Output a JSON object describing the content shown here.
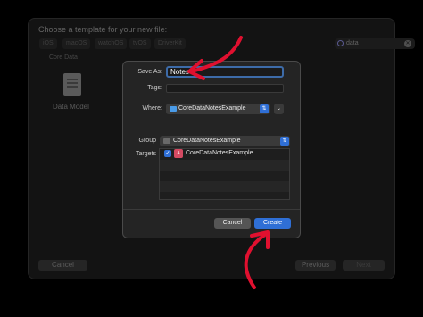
{
  "template_window": {
    "title": "Choose a template for your new file:",
    "platform_tabs": [
      "iOS",
      "macOS",
      "watchOS",
      "tvOS",
      "DriverKit"
    ],
    "search_value": "data",
    "section_label": "Core Data",
    "item_label": "Data Model",
    "cancel_label": "Cancel",
    "previous_label": "Previous",
    "next_label": "Next"
  },
  "save_sheet": {
    "save_as_label": "Save As:",
    "save_as_value": "Notes",
    "tags_label": "Tags:",
    "where_label": "Where:",
    "where_value": "CoreDataNotesExample",
    "group_label": "Group",
    "group_value": "CoreDataNotesExample",
    "targets_label": "Targets",
    "targets": [
      {
        "name": "CoreDataNotesExample",
        "checked": true
      }
    ],
    "cancel_label": "Cancel",
    "create_label": "Create"
  },
  "annotation_color": "#e0102f",
  "icons": [
    "search-icon",
    "clear-icon",
    "document-icon",
    "folder-icon",
    "chevron-updown-icon",
    "chevron-down-icon",
    "checkbox-icon",
    "app-icon"
  ]
}
